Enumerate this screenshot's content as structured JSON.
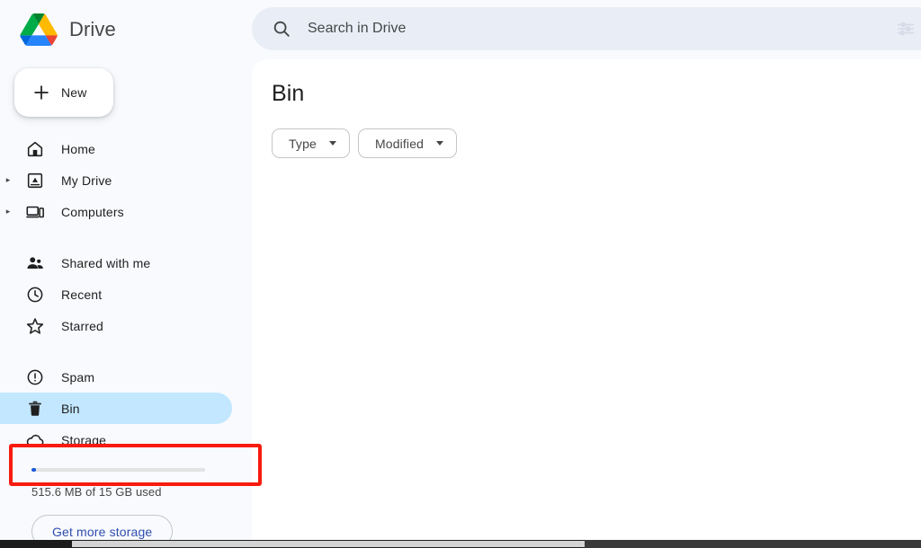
{
  "brand": {
    "name": "Drive",
    "logo_icon": "google-drive-logo"
  },
  "search": {
    "placeholder": "Search in Drive",
    "value": "",
    "icon": "search-icon",
    "filter_icon": "tune-icon"
  },
  "sidebar": {
    "new_button": {
      "label": "New",
      "icon": "plus-icon"
    },
    "groups": [
      {
        "items": [
          {
            "label": "Home",
            "icon": "home-icon",
            "caret": false,
            "selected": false
          },
          {
            "label": "My Drive",
            "icon": "my-drive-icon",
            "caret": true,
            "selected": false
          },
          {
            "label": "Computers",
            "icon": "computers-icon",
            "caret": true,
            "selected": false
          }
        ]
      },
      {
        "items": [
          {
            "label": "Shared with me",
            "icon": "people-icon",
            "caret": false,
            "selected": false
          },
          {
            "label": "Recent",
            "icon": "clock-icon",
            "caret": false,
            "selected": false
          },
          {
            "label": "Starred",
            "icon": "star-icon",
            "caret": false,
            "selected": false
          }
        ]
      },
      {
        "items": [
          {
            "label": "Spam",
            "icon": "exclamation-circle-icon",
            "caret": false,
            "selected": false
          },
          {
            "label": "Bin",
            "icon": "trash-icon",
            "caret": false,
            "selected": true
          },
          {
            "label": "Storage",
            "icon": "cloud-icon",
            "caret": false,
            "selected": false
          }
        ]
      }
    ],
    "storage": {
      "used_text": "515.6 MB of 15 GB used",
      "percent_used": 3,
      "button_label": "Get more storage",
      "bar_fill_color": "#1a56db",
      "button_text_color": "#2f4db0"
    }
  },
  "main": {
    "title": "Bin",
    "chips": [
      {
        "label": "Type",
        "icon": "chevron-down-icon"
      },
      {
        "label": "Modified",
        "icon": "chevron-down-icon"
      }
    ],
    "loading": {
      "icon": "loading-spinner",
      "color": "#1a73e8"
    }
  },
  "annotation": {
    "target": "Bin",
    "color": "#f81b0e"
  },
  "colors": {
    "page_background": "#f8fafd",
    "panel_background": "#ffffff",
    "search_background": "#e9eef6",
    "selected_item_background": "#c2e7ff",
    "text_primary": "#1f1f1f",
    "text_secondary": "#444746"
  }
}
